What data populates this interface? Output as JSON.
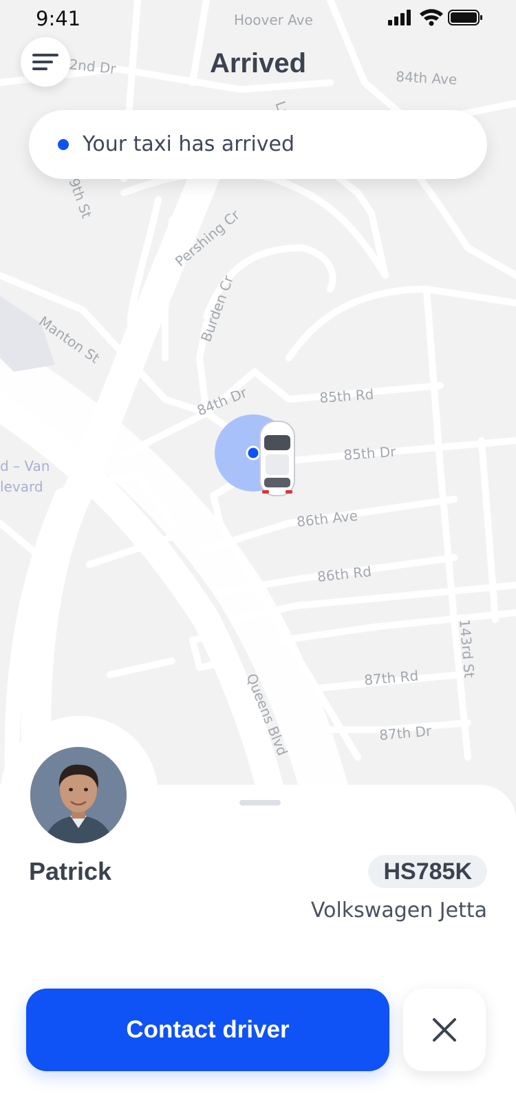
{
  "status": {
    "time": "9:41"
  },
  "header": {
    "title": "Arrived"
  },
  "notice": {
    "text": "Your taxi has arrived"
  },
  "map": {
    "streets": {
      "hoover_ave": "Hoover Ave",
      "second_dr": "2nd Dr",
      "ave_84th": "84th Ave",
      "lane_fragment": "Lan",
      "st_fragment": "9th St",
      "pershing_cr": "Pershing Cr",
      "burden_cr": "Burden Cr",
      "manton_st": "Manton St",
      "dr_84th": "84th Dr",
      "rd_85th": "85th Rd",
      "dr_85th": "85th Dr",
      "van_fragment": "d – Van",
      "levard_fragment": "levard",
      "ave_86th": "86th Ave",
      "rd_86th": "86th Rd",
      "st_143rd": "143rd St",
      "queens_blvd": "Queens Blvd",
      "rd_87th": "87th Rd",
      "dr_87th": "87th Dr"
    }
  },
  "driver": {
    "name": "Patrick",
    "plate": "HS785K",
    "car_model": "Volkswagen Jetta"
  },
  "actions": {
    "contact_label": "Contact driver"
  },
  "colors": {
    "accent": "#0F52F5",
    "text_dark": "#3B4250",
    "map_bg": "#F2F2F3",
    "road": "#FFFFFF",
    "label": "#A3A8AE"
  },
  "icons": {
    "menu": "menu-icon",
    "close": "close-icon",
    "car": "car-icon",
    "location": "location-pin-icon"
  }
}
